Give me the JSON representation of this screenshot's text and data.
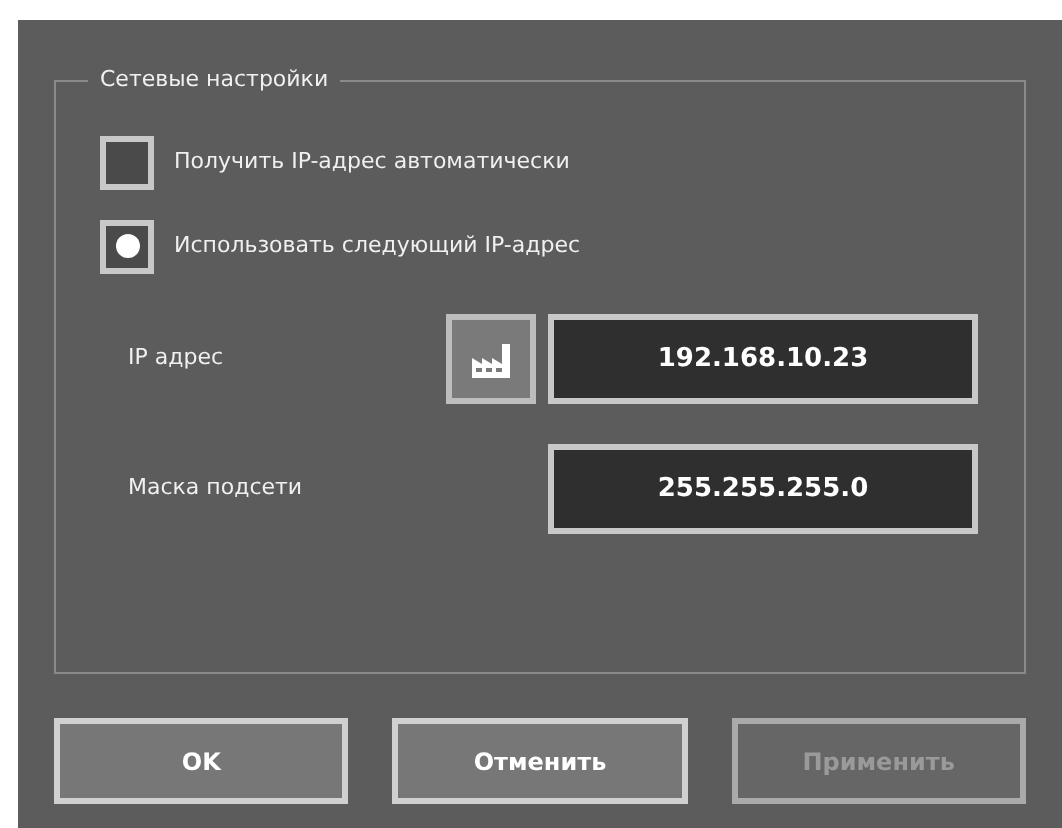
{
  "group": {
    "title": "Сетевые настройки",
    "options": [
      {
        "label": "Получить IP-адрес автоматически",
        "selected": false
      },
      {
        "label": "Использовать следующий IP-адрес",
        "selected": true
      }
    ],
    "fields": [
      {
        "label": "IP адрес",
        "value": "192.168.10.23",
        "kind": "with-button"
      },
      {
        "label": "Маска подсети",
        "value": "255.255.255.0",
        "kind": "plain"
      }
    ]
  },
  "buttons": [
    {
      "label": "OK",
      "disabled": false
    },
    {
      "label": "Отменить",
      "disabled": false
    },
    {
      "label": "Применить",
      "disabled": true
    }
  ]
}
